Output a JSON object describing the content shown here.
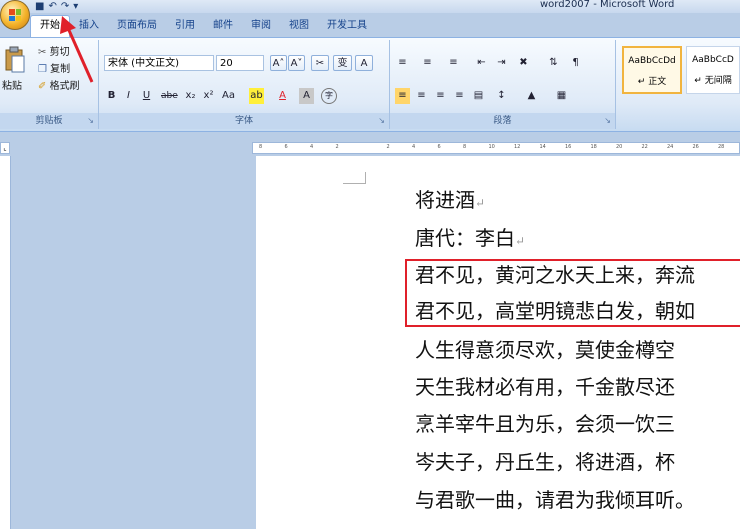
{
  "window": {
    "title": "word2007 - Microsoft Word"
  },
  "quick_access": {
    "save_icon": "save-icon",
    "undo": "↶",
    "redo": "↷",
    "more": "▾"
  },
  "tabs": [
    "开始",
    "插入",
    "页面布局",
    "引用",
    "邮件",
    "审阅",
    "视图",
    "开发工具"
  ],
  "clipboard": {
    "paste_label": "粘贴",
    "cut_label": "剪切",
    "copy_label": "复制",
    "format_painter_label": "格式刷",
    "group_label": "剪贴板"
  },
  "font": {
    "name_value": "宋体 (中文正文)",
    "size_value": "20",
    "group_label": "字体",
    "grow": "A˄",
    "shrink": "A˅",
    "clear": "✂",
    "phonetic": "变",
    "border_char": "A",
    "bold": "B",
    "italic": "I",
    "underline": "U",
    "strike": "abe",
    "sub": "x₂",
    "sup": "x²",
    "case": "Aa",
    "highlight": "ab",
    "color": "A",
    "shade": "A",
    "enclose": "字"
  },
  "paragraph": {
    "group_label": "段落"
  },
  "styles": {
    "normal_sample": "AaBbCcDd",
    "normal_label": "↵ 正文",
    "nospacing_sample": "AaBbCcD",
    "nospacing_label": "↵ 无间隔"
  },
  "ruler": {
    "ticks": [
      "8",
      "6",
      "4",
      "2",
      "",
      "2",
      "4",
      "6",
      "8",
      "10",
      "12",
      "14",
      "16",
      "18",
      "20",
      "22",
      "24",
      "26",
      "28"
    ]
  },
  "document": {
    "lines": [
      "将进酒",
      "唐代：李白",
      "君不见，黄河之水天上来，奔流",
      "君不见，高堂明镜悲白发，朝如",
      "人生得意须尽欢，莫使金樽空",
      "天生我材必有用，千金散尽还",
      "烹羊宰牛且为乐，会须一饮三",
      "岑夫子，丹丘生，将进酒，杯",
      "与君歌一曲，请君为我倾耳听。"
    ],
    "paragraph_mark": "↵"
  },
  "colors": {
    "annotation_red": "#e0202a",
    "ribbon_blue": "#c3d7ef",
    "accent": "#f1b43f"
  }
}
